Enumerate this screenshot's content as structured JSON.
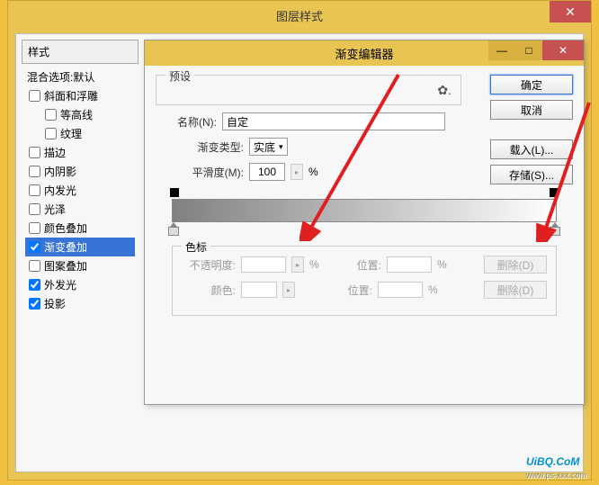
{
  "outer": {
    "title": "图层样式",
    "close": "✕"
  },
  "styles": {
    "header": "样式",
    "blend": "混合选项:默认",
    "items": [
      {
        "label": "斜面和浮雕",
        "checked": false,
        "indent": false
      },
      {
        "label": "等高线",
        "checked": false,
        "indent": true
      },
      {
        "label": "纹理",
        "checked": false,
        "indent": true
      },
      {
        "label": "描边",
        "checked": false,
        "indent": false
      },
      {
        "label": "内阴影",
        "checked": false,
        "indent": false
      },
      {
        "label": "内发光",
        "checked": false,
        "indent": false
      },
      {
        "label": "光泽",
        "checked": false,
        "indent": false
      },
      {
        "label": "颜色叠加",
        "checked": false,
        "indent": false
      },
      {
        "label": "渐变叠加",
        "checked": true,
        "indent": false,
        "selected": true
      },
      {
        "label": "图案叠加",
        "checked": false,
        "indent": false
      },
      {
        "label": "外发光",
        "checked": true,
        "indent": false
      },
      {
        "label": "投影",
        "checked": true,
        "indent": false
      }
    ]
  },
  "right_stub": "渐",
  "inner": {
    "title": "渐变编辑器",
    "min": "—",
    "max": "□",
    "close": "✕",
    "preset_label": "预设",
    "gear": "✿.",
    "name_label": "名称(N):",
    "name_value": "自定",
    "type_label": "渐变类型:",
    "type_value": "实底",
    "smooth_label": "平滑度(M):",
    "smooth_value": "100",
    "smooth_unit": "%",
    "buttons": {
      "ok": "确定",
      "cancel": "取消",
      "load": "载入(L)...",
      "save": "存储(S)..."
    },
    "marks": {
      "label": "色标",
      "opacity_label": "不透明度:",
      "color_label": "颜色:",
      "pos_label": "位置:",
      "pct": "%",
      "delete": "删除(D)"
    }
  },
  "watermark": {
    "main": "UiBQ.CoM",
    "sub": "www.ps-xxx.com"
  }
}
